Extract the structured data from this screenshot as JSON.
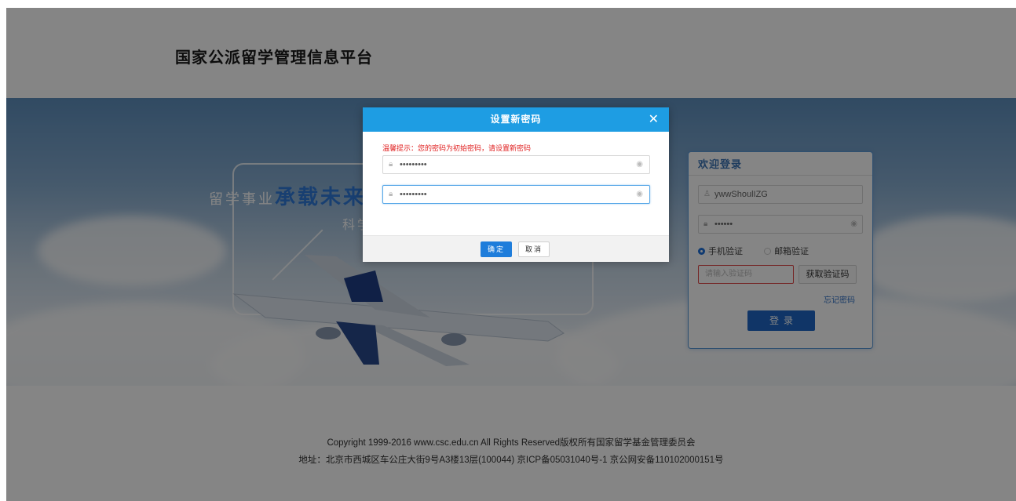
{
  "header": {
    "site_title": "国家公派留学管理信息平台"
  },
  "banner": {
    "slogan_prefix": "留学事业",
    "slogan_emphasis": "承载未来",
    "slogan_sub": "科学"
  },
  "login": {
    "title": "欢迎登录",
    "username_value": "ywwShoulIZG",
    "password_value": "••••••",
    "verify_options": [
      {
        "label": "手机验证",
        "selected": true
      },
      {
        "label": "邮箱验证",
        "selected": false
      }
    ],
    "code_placeholder": "请输入验证码",
    "get_code_label": "获取验证码",
    "forgot_label": "忘记密码",
    "login_label": "登录"
  },
  "footer": {
    "copyright": "Copyright 1999-2016 www.csc.edu.cn All Rights Reserved版权所有国家留学基金管理委员会",
    "address": "地址：北京市西城区车公庄大街9号A3楼13层(100044) 京ICP备05031040号-1 京公网安备110102000151号"
  },
  "modal": {
    "title": "设置新密码",
    "close_symbol": "✕",
    "hint": "温馨提示：您的密码为初始密码，请设置新密码",
    "new_password_value": "•••••••••",
    "confirm_password_value": "•••••••••",
    "ok_label": "确定",
    "cancel_label": "取消"
  },
  "colors": {
    "modal_header": "#1e9de3",
    "primary_button": "#1e7ddb",
    "login_button": "#1f67c6",
    "hint_text": "#e02020",
    "overlay": "rgba(0,0,0,0.48)"
  },
  "icons": {
    "lock": "lock-icon",
    "user": "user-icon",
    "eye": "eye-icon",
    "close": "close-icon"
  }
}
